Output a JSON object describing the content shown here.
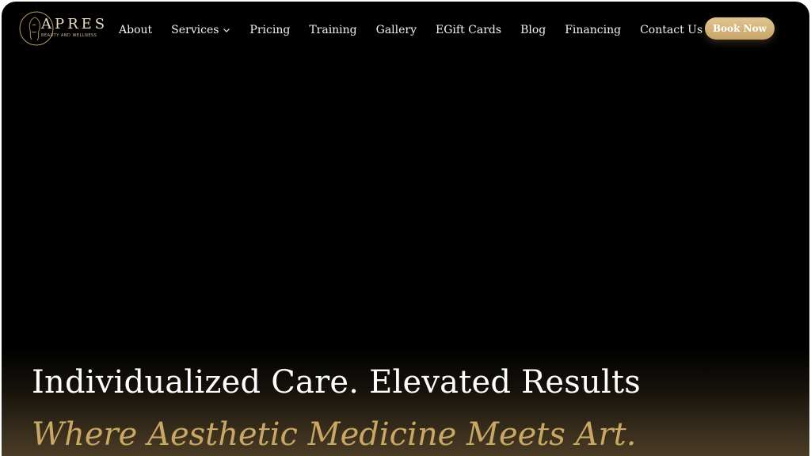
{
  "brand": {
    "name": "APRES",
    "tagline": "BEAUTY AND WELLNESS",
    "accent_color": "#c9a866"
  },
  "nav": {
    "items": [
      {
        "label": "About"
      },
      {
        "label": "Services",
        "has_dropdown": true
      },
      {
        "label": "Pricing"
      },
      {
        "label": "Training"
      },
      {
        "label": "Gallery"
      },
      {
        "label": "EGift Cards"
      },
      {
        "label": "Blog"
      },
      {
        "label": "Financing"
      },
      {
        "label": "Contact Us"
      }
    ],
    "dropdown_icon": "chevron-down-icon"
  },
  "cta": {
    "label": "Book Now",
    "color": "#d4b47c"
  },
  "hero": {
    "title": "Individualized Care. Elevated Results",
    "subtitle": "Where Aesthetic Medicine Meets Art."
  }
}
